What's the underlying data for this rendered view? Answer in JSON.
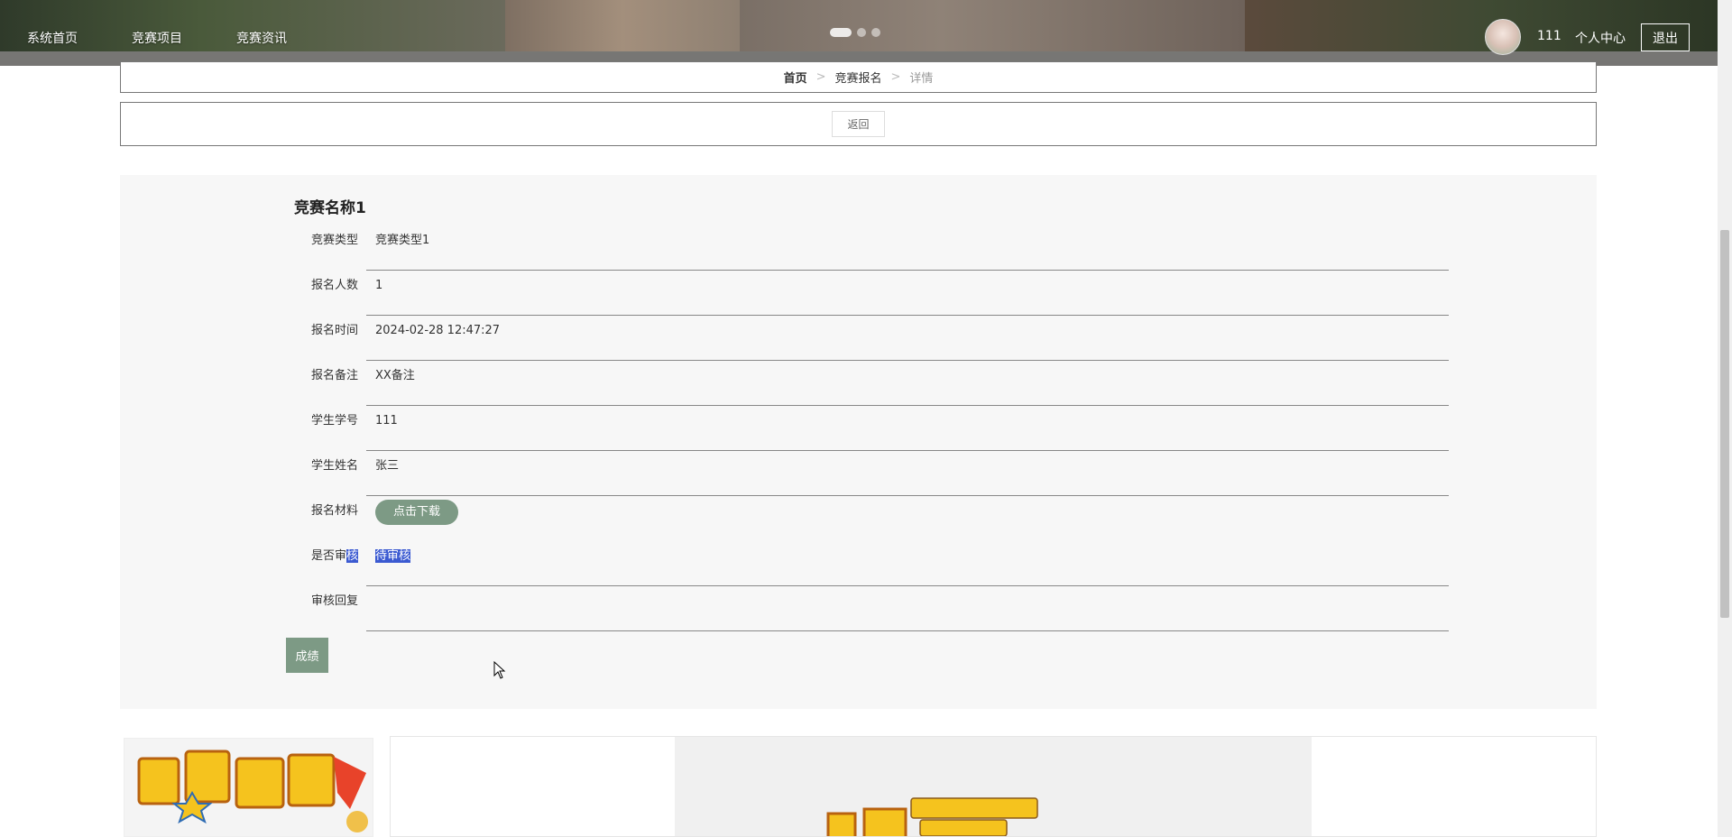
{
  "nav": {
    "items": [
      {
        "label": "系统首页"
      },
      {
        "label": "竞赛项目"
      },
      {
        "label": "竞赛资讯"
      }
    ]
  },
  "user": {
    "name": "111",
    "center_label": "个人中心",
    "logout_label": "退出"
  },
  "breadcrumb": {
    "home": "首页",
    "section": "竞赛报名",
    "current": "详情",
    "separator": ">"
  },
  "back_label": "返回",
  "detail": {
    "title": "竞赛名称1",
    "fields": [
      {
        "label": "竞赛类型",
        "value": "竞赛类型1"
      },
      {
        "label": "报名人数",
        "value": "1"
      },
      {
        "label": "报名时间",
        "value": "2024-02-28 12:47:27"
      },
      {
        "label": "报名备注",
        "value": "XX备注"
      },
      {
        "label": "学生学号",
        "value": "111"
      },
      {
        "label": "学生姓名",
        "value": "张三"
      },
      {
        "label": "报名材料",
        "button": "点击下载"
      },
      {
        "label_prefix": "是否审",
        "label_selected": "核",
        "value_selected": "待审核"
      },
      {
        "label": "审核回复",
        "value": ""
      }
    ],
    "score_button": "成绩"
  },
  "colors": {
    "accent_green": "#7d9a85",
    "selection_blue": "#3b5ad1"
  }
}
